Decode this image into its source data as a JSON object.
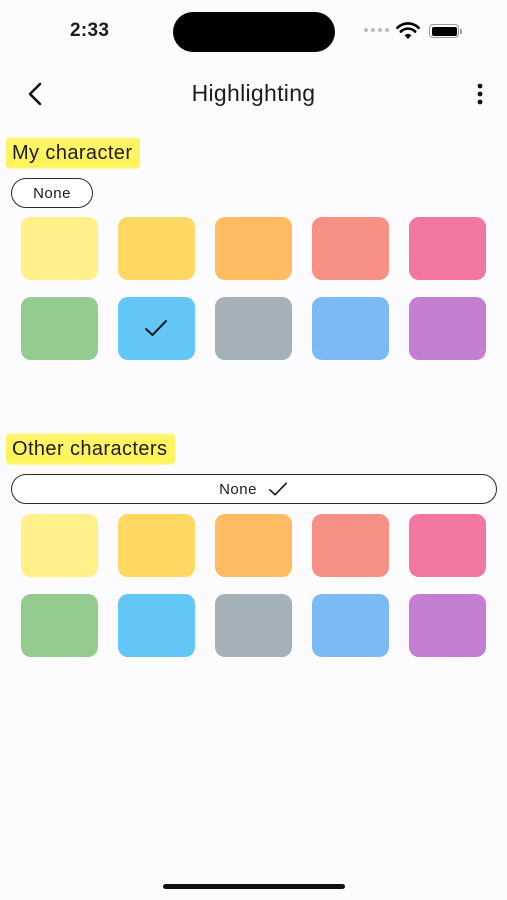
{
  "status": {
    "time": "2:33"
  },
  "nav": {
    "title": "Highlighting",
    "back_icon": "chevron-left-icon",
    "more_icon": "ellipsis-vertical-icon"
  },
  "sections": [
    {
      "label": "My character",
      "none_label": "None",
      "none_selected": false,
      "selected_swatch": 6,
      "swatches": [
        "#fff08a",
        "#ffd864",
        "#ffbb62",
        "#f68f84",
        "#f177a1",
        "#93cc8e",
        "#62c6f6",
        "#a4b1b8",
        "#7cbaf6",
        "#c27ecf"
      ]
    },
    {
      "label": "Other characters",
      "none_label": "None",
      "none_selected": true,
      "selected_swatch": -1,
      "swatches": [
        "#fff08a",
        "#ffd864",
        "#ffbb62",
        "#f68f84",
        "#f177a1",
        "#93cc8e",
        "#62c6f6",
        "#a4b1b8",
        "#7cbaf6",
        "#c27ecf"
      ]
    }
  ],
  "colors": {
    "highlight": "#fff356",
    "background": "#fcfbfe"
  }
}
